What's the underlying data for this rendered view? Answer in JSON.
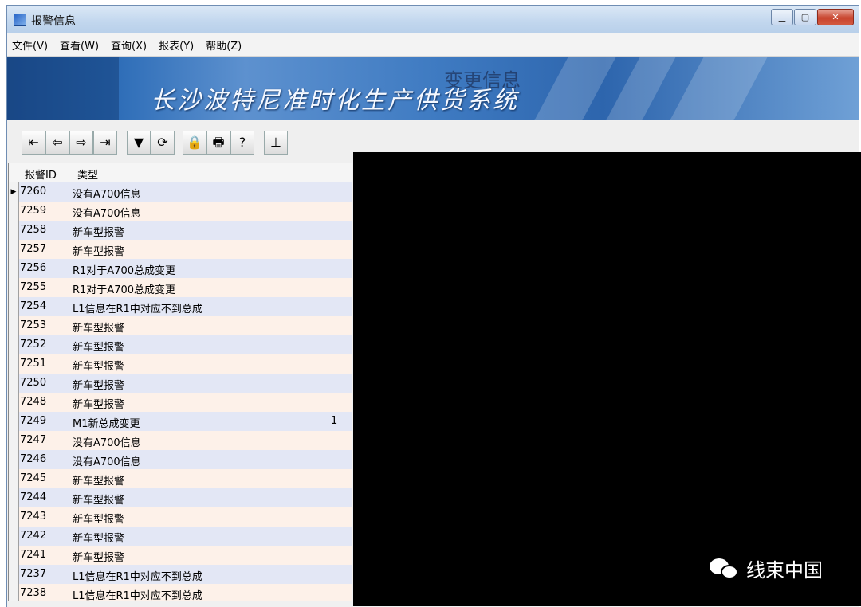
{
  "window": {
    "title": "报警信息"
  },
  "menu": [
    "文件(V)",
    "查看(W)",
    "查询(X)",
    "报表(Y)",
    "帮助(Z)"
  ],
  "banner": {
    "title": "长沙波特尼准时化生产供货系统",
    "overlay": "变更信息"
  },
  "toolbar": [
    {
      "icon": "first-record-icon",
      "glyph": "⇤"
    },
    {
      "icon": "previous-record-icon",
      "glyph": "⇦"
    },
    {
      "icon": "next-record-icon",
      "glyph": "⇨"
    },
    {
      "icon": "last-record-icon",
      "glyph": "⇥"
    },
    {
      "icon": "filter-icon",
      "glyph": "▼"
    },
    {
      "icon": "refresh-icon",
      "glyph": "⟳"
    },
    {
      "icon": "lock-icon",
      "glyph": "🔒"
    },
    {
      "icon": "print-icon",
      "glyph": "🖶"
    },
    {
      "icon": "help-icon",
      "glyph": "?"
    },
    {
      "icon": "exit-icon",
      "glyph": "⊥"
    }
  ],
  "grid": {
    "headers": {
      "id": "报警ID",
      "type": "类型"
    },
    "rows": [
      {
        "id": "7260",
        "type": "没有A700信息",
        "extra": ""
      },
      {
        "id": "7259",
        "type": "没有A700信息",
        "extra": ""
      },
      {
        "id": "7258",
        "type": "新车型报警",
        "extra": ""
      },
      {
        "id": "7257",
        "type": "新车型报警",
        "extra": ""
      },
      {
        "id": "7256",
        "type": "R1对于A700总成变更",
        "extra": ""
      },
      {
        "id": "7255",
        "type": "R1对于A700总成变更",
        "extra": ""
      },
      {
        "id": "7254",
        "type": "L1信息在R1中对应不到总成",
        "extra": ""
      },
      {
        "id": "7253",
        "type": "新车型报警",
        "extra": ""
      },
      {
        "id": "7252",
        "type": "新车型报警",
        "extra": ""
      },
      {
        "id": "7251",
        "type": "新车型报警",
        "extra": ""
      },
      {
        "id": "7250",
        "type": "新车型报警",
        "extra": ""
      },
      {
        "id": "7248",
        "type": "新车型报警",
        "extra": ""
      },
      {
        "id": "7249",
        "type": "M1新总成变更",
        "extra": "1"
      },
      {
        "id": "7247",
        "type": "没有A700信息",
        "extra": ""
      },
      {
        "id": "7246",
        "type": "没有A700信息",
        "extra": ""
      },
      {
        "id": "7245",
        "type": "新车型报警",
        "extra": ""
      },
      {
        "id": "7244",
        "type": "新车型报警",
        "extra": ""
      },
      {
        "id": "7243",
        "type": "新车型报警",
        "extra": ""
      },
      {
        "id": "7242",
        "type": "新车型报警",
        "extra": ""
      },
      {
        "id": "7241",
        "type": "新车型报警",
        "extra": ""
      },
      {
        "id": "7237",
        "type": "L1信息在R1中对应不到总成",
        "extra": ""
      },
      {
        "id": "7238",
        "type": "L1信息在R1中对应不到总成",
        "extra": ""
      }
    ]
  },
  "watermark": {
    "text": "线束中国",
    "icon": "wechat-icon"
  }
}
